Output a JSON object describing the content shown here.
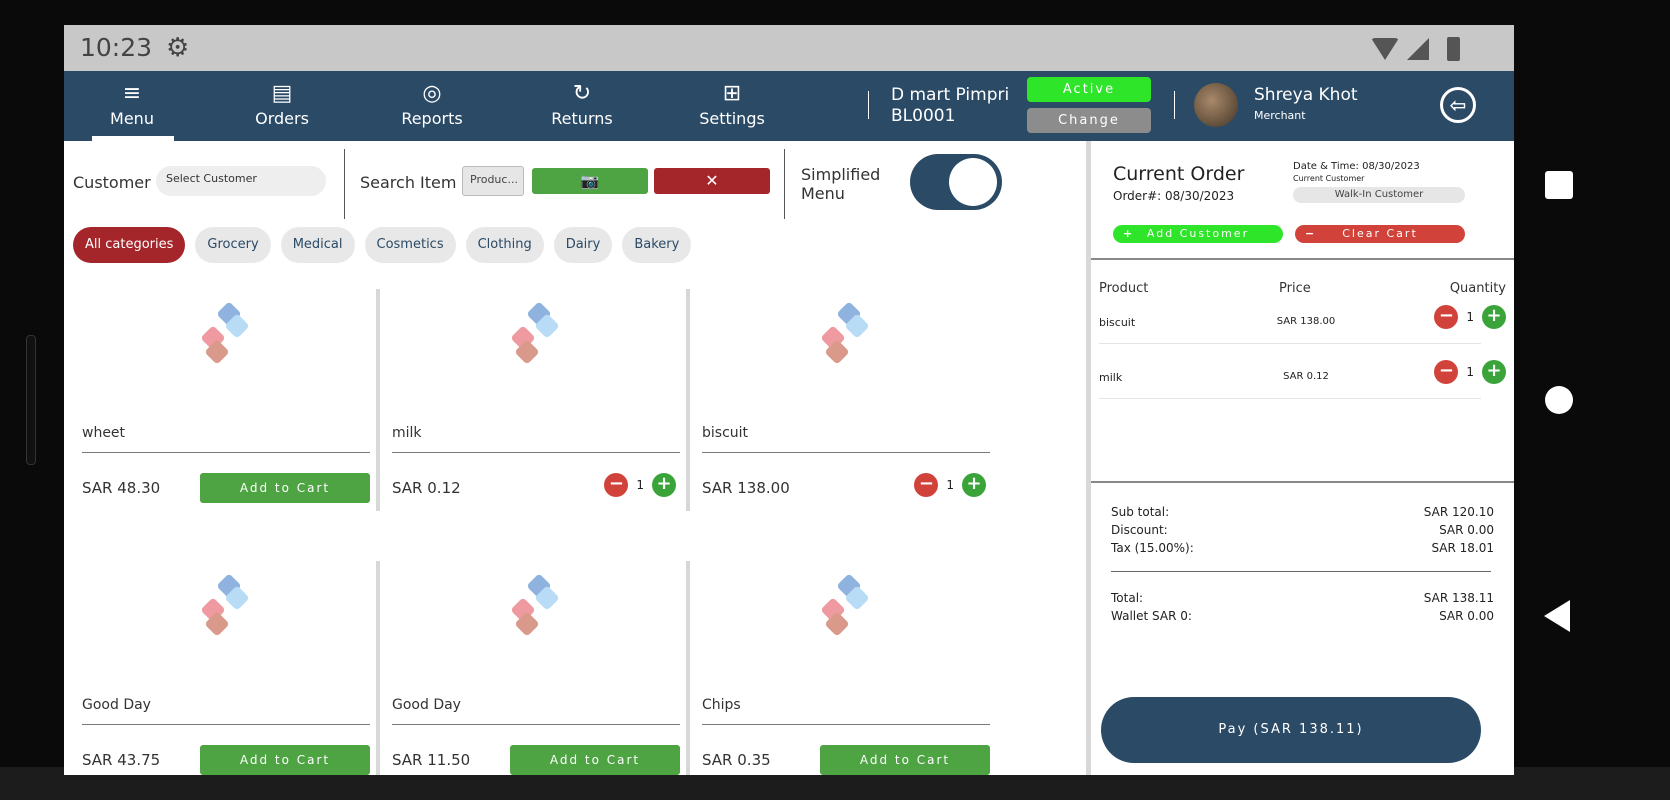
{
  "status": {
    "time": "10:23",
    "gear_icon": "gear-icon"
  },
  "nav": {
    "items": [
      {
        "label": "Menu",
        "icon": "≡"
      },
      {
        "label": "Orders",
        "icon": "▤"
      },
      {
        "label": "Reports",
        "icon": "◎"
      },
      {
        "label": "Returns",
        "icon": "↻"
      },
      {
        "label": "Settings",
        "icon": "⊞"
      }
    ],
    "store": {
      "name": "D mart Pimpri",
      "code": "BL0001"
    },
    "active_label": "Active",
    "change_label": "Change",
    "user": {
      "name": "Shreya Khot",
      "role": "Merchant"
    }
  },
  "filters": {
    "customer_label": "Customer",
    "customer_placeholder": "Select Customer",
    "search_label": "Search Item",
    "search_placeholder": "Produc...",
    "simplified_label": "Simplified Menu"
  },
  "categories": [
    "All categories",
    "Grocery",
    "Medical",
    "Cosmetics",
    "Clothing",
    "Dairy",
    "Bakery"
  ],
  "add_to_cart_label": "Add to Cart",
  "products": [
    {
      "name": "wheet",
      "price": "SAR 48.30",
      "qty": null
    },
    {
      "name": "milk",
      "price": "SAR 0.12",
      "qty": "1"
    },
    {
      "name": "biscuit",
      "price": "SAR 138.00",
      "qty": "1"
    },
    {
      "name": "Good Day",
      "price": "SAR 43.75",
      "qty": null
    },
    {
      "name": "Good Day",
      "price": "SAR 11.50",
      "qty": null
    },
    {
      "name": "Chips",
      "price": "SAR 0.35",
      "qty": null
    }
  ],
  "order": {
    "title": "Current Order",
    "order_no": "Order#: 08/30/2023",
    "date_time": "Date & Time: 08/30/2023",
    "current_customer_label": "Current Customer",
    "customer": "Walk-In Customer",
    "add_customer_label": "Add Customer",
    "clear_cart_label": "Clear Cart",
    "columns": [
      "Product",
      "Price",
      "Quantity"
    ],
    "items": [
      {
        "name": "biscuit",
        "price": "SAR 138.00",
        "qty": "1"
      },
      {
        "name": "milk",
        "price": "SAR 0.12",
        "qty": "1"
      }
    ],
    "summary": {
      "subtotal_label": "Sub total:",
      "subtotal": "SAR 120.10",
      "discount_label": "Discount:",
      "discount": "SAR 0.00",
      "tax_label": "Tax (15.00%):",
      "tax": "SAR 18.01",
      "total_label": "Total:",
      "total": "SAR 138.11",
      "wallet_label": "Wallet SAR 0:",
      "wallet": "SAR 0.00"
    },
    "pay_label": "Pay (SAR 138.11)"
  },
  "colors": {
    "primary": "#2b4a66",
    "green": "#4ea343",
    "bright_green": "#2fe52a",
    "red": "#a4252a",
    "minus_red": "#d1433a"
  }
}
